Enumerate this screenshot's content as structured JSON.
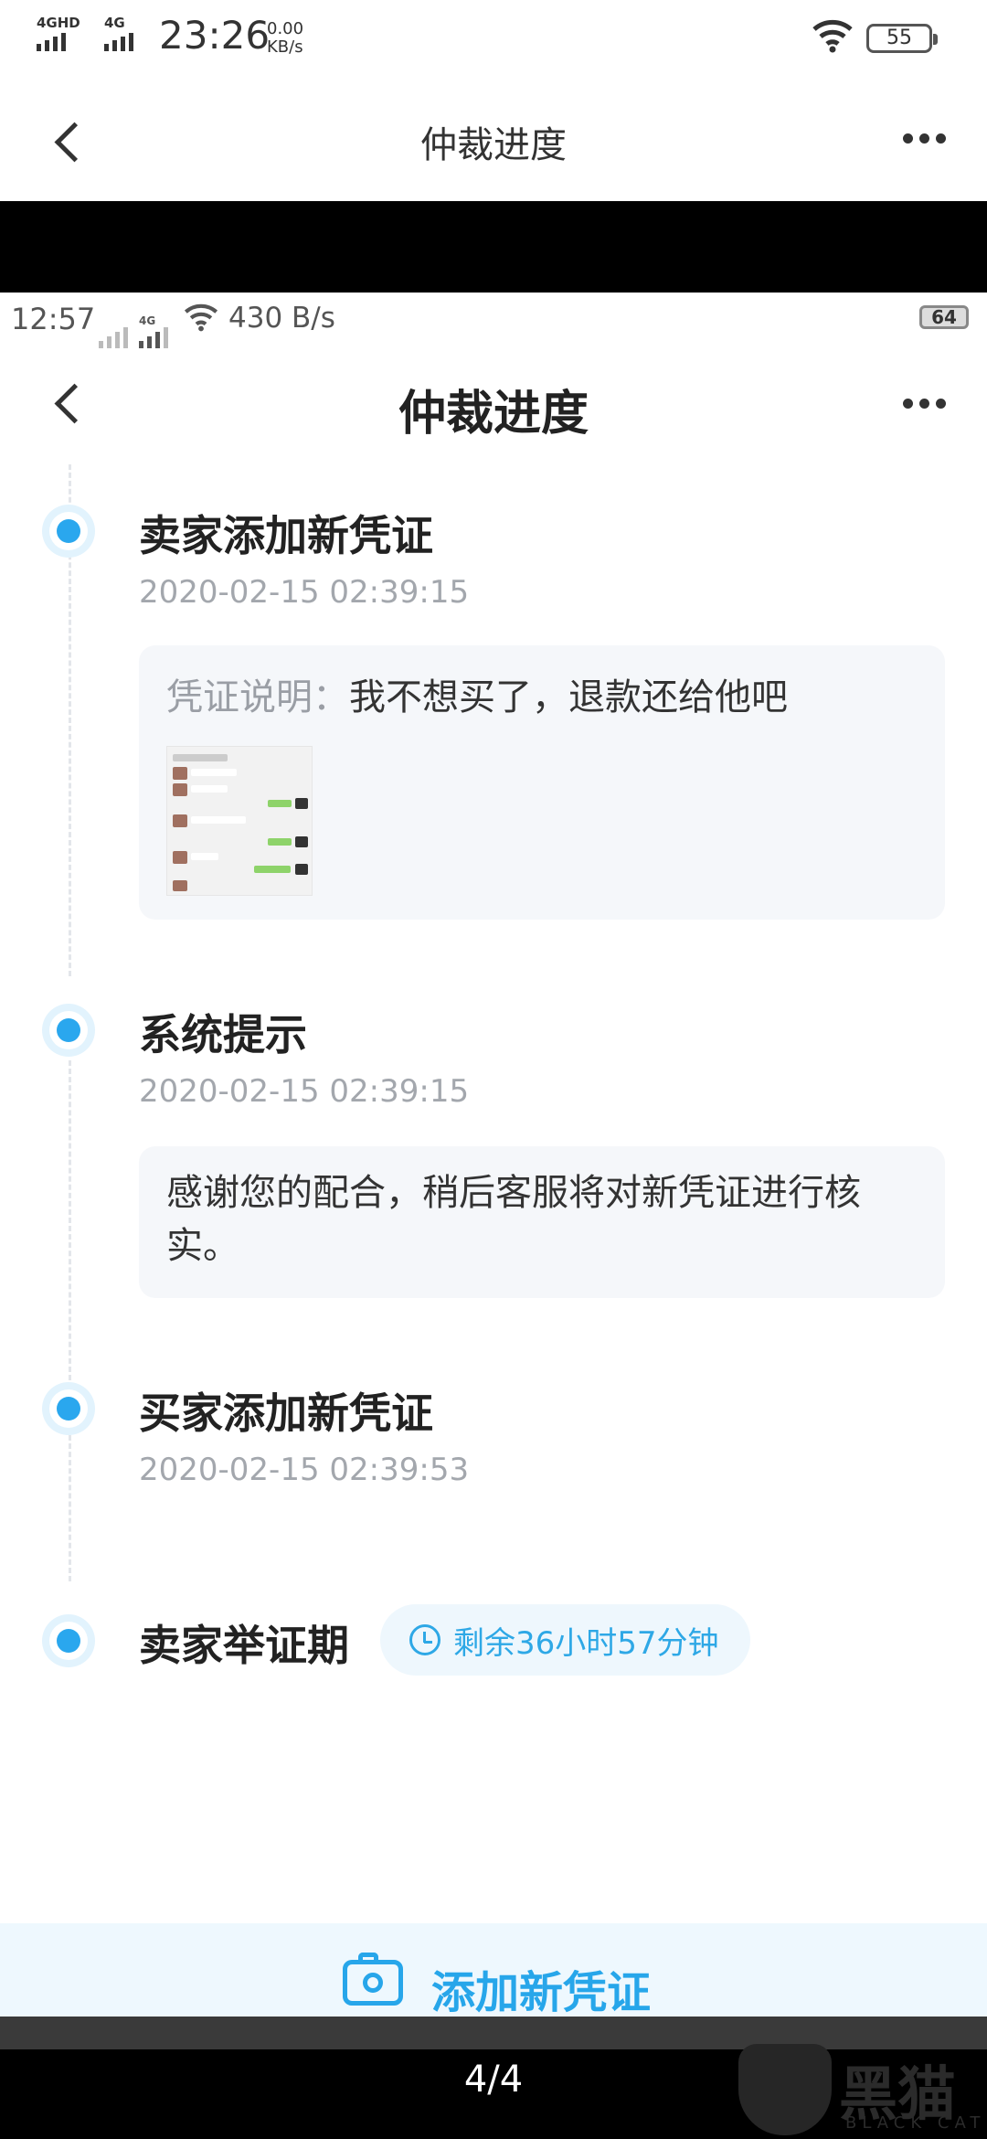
{
  "outer_status": {
    "network1": "4GHD",
    "network2": "4G",
    "time": "23:26",
    "speed_value": "0.00",
    "speed_unit": "KB/s",
    "battery": "55"
  },
  "outer_header": {
    "title": "仲裁进度"
  },
  "inner_status": {
    "time": "12:57",
    "network": "4G",
    "speed": "430 B/s",
    "battery": "64"
  },
  "inner_header": {
    "title": "仲裁进度"
  },
  "timeline": [
    {
      "title": "卖家添加新凭证",
      "time": "2020-02-15 02:39:15",
      "card_label": "凭证说明：",
      "card_text": "我不想买了，退款还给他吧",
      "has_image": true
    },
    {
      "title": "系统提示",
      "time": "2020-02-15 02:39:15",
      "card_text": "感谢您的配合，稍后客服将对新凭证进行核实。"
    },
    {
      "title": "买家添加新凭证",
      "time": "2020-02-15 02:39:53"
    },
    {
      "title": "卖家举证期",
      "countdown": "剩余36小时57分钟"
    }
  ],
  "action": {
    "label": "添加新凭证"
  },
  "viewer": {
    "page": "4/4"
  },
  "watermark": {
    "text": "黑猫",
    "sub": "BLACK CAT"
  },
  "colors": {
    "accent": "#2aa7ee",
    "card_bg": "#f5f7fa",
    "bottom_bg": "#eef8fe"
  }
}
